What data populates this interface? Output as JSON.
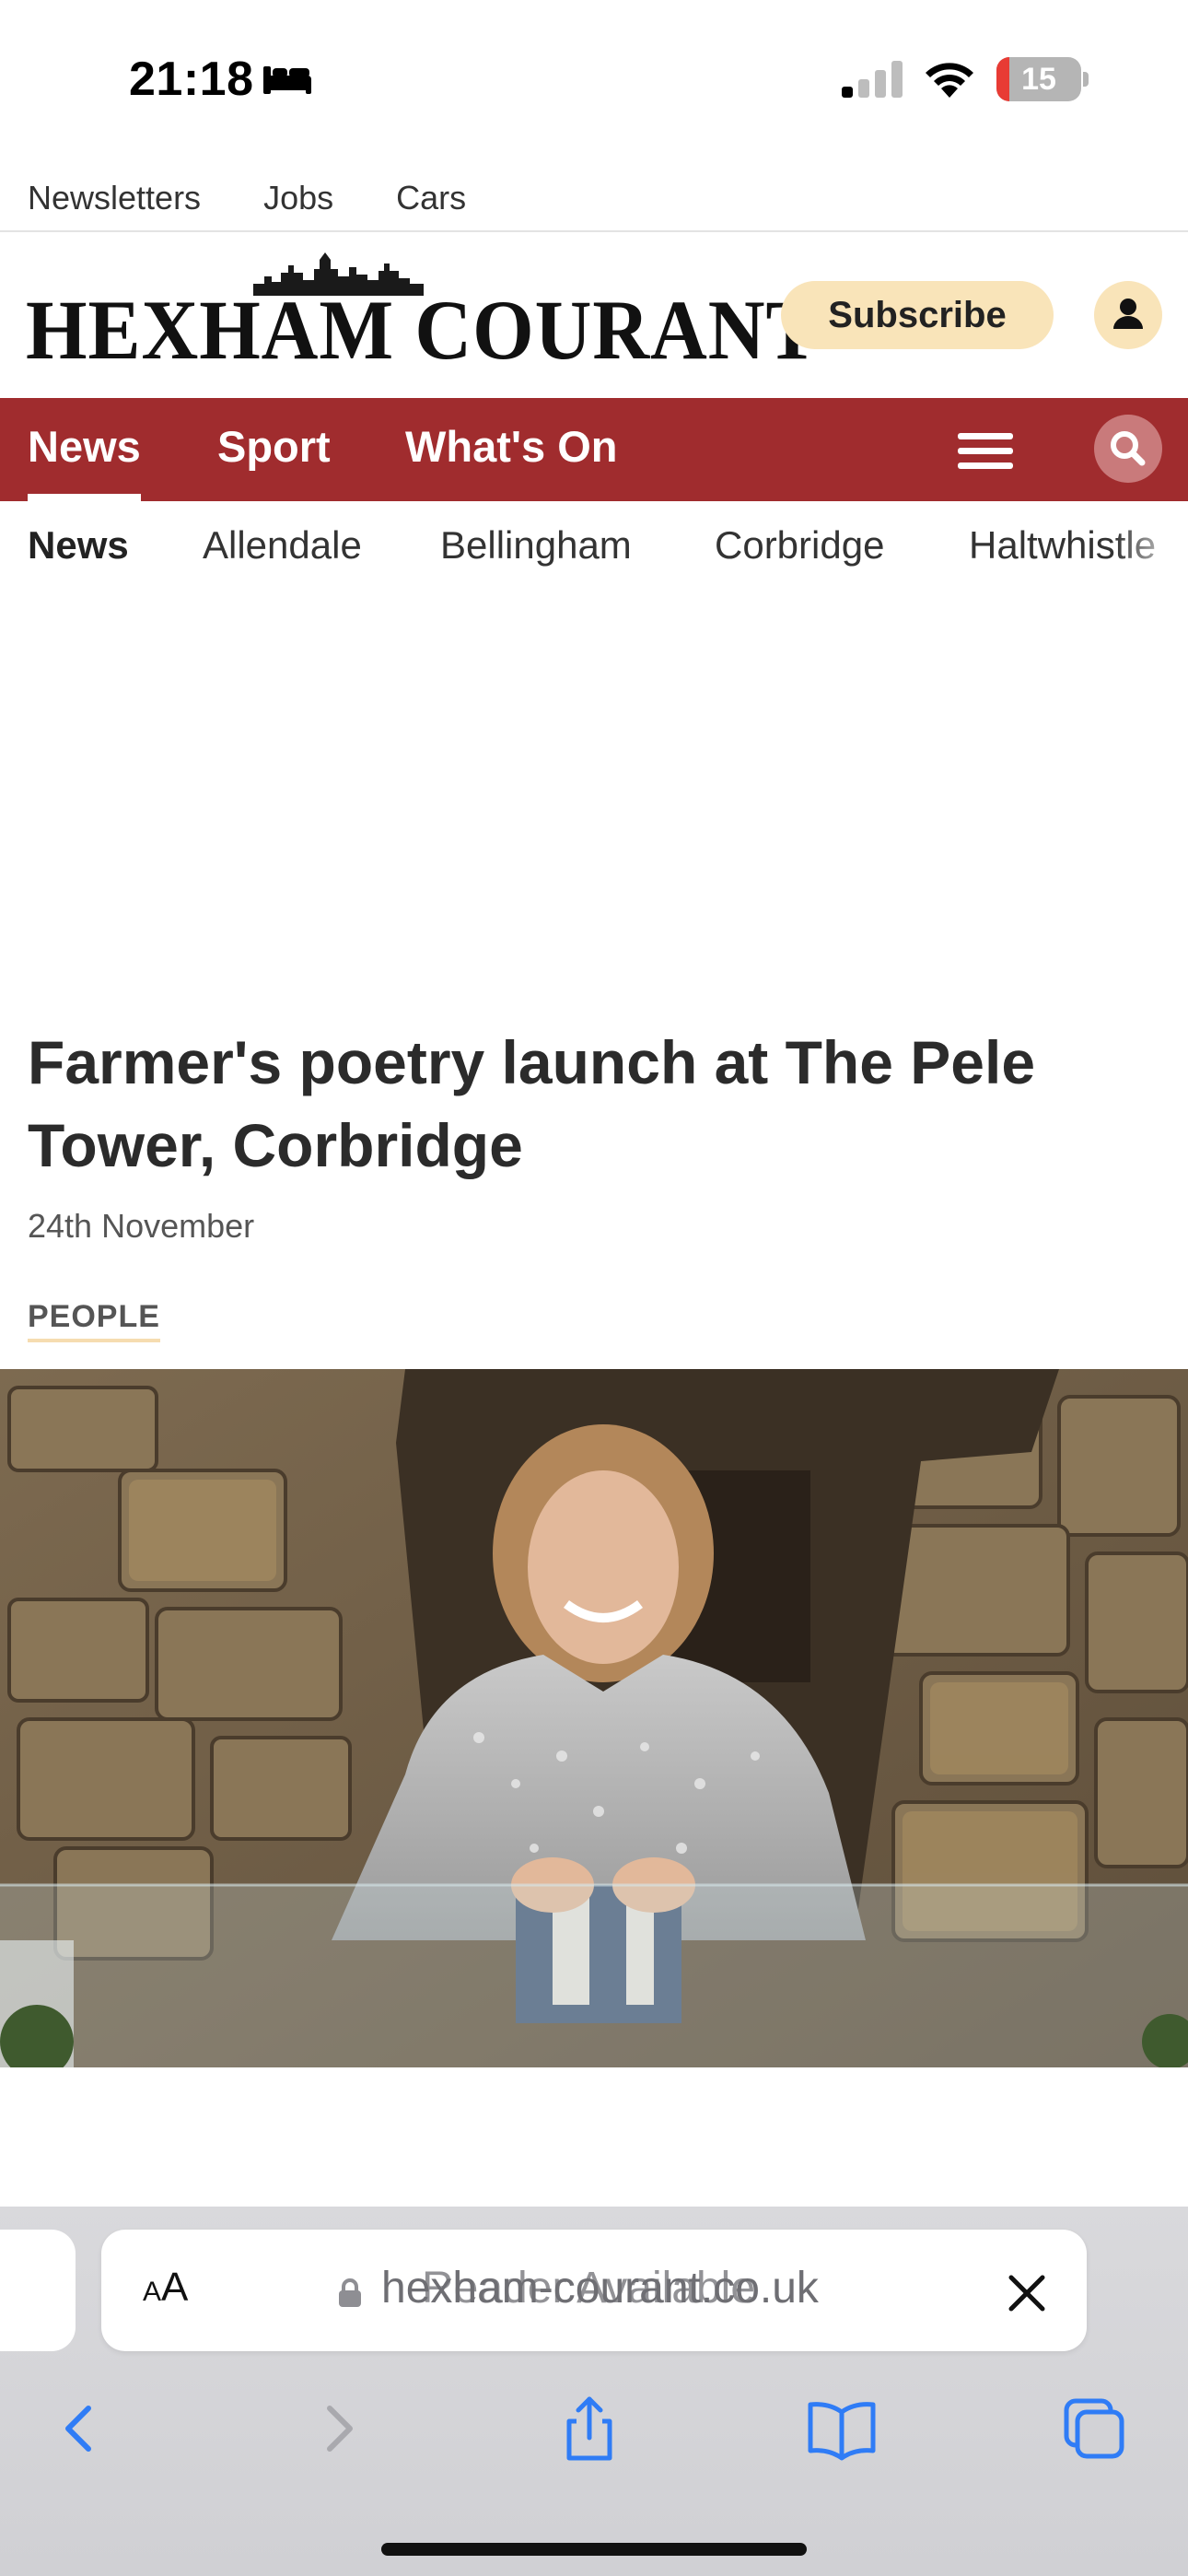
{
  "status_bar": {
    "time": "21:18",
    "battery_level": "15",
    "icons": [
      "bed-icon",
      "cellular-signal-icon",
      "wifi-icon",
      "battery-icon"
    ],
    "battery_color": "#e83b34"
  },
  "top_links": [
    "Newsletters",
    "Jobs",
    "Cars"
  ],
  "masthead": {
    "logo_text": "HEXHAM COURANT",
    "subscribe_label": "Subscribe",
    "account_icon": "user-icon",
    "brand_color": "#a02c2e",
    "accent_color": "#f9e4b9"
  },
  "main_nav": {
    "tabs": [
      "News",
      "Sport",
      "What's On"
    ],
    "active_tab": "News",
    "menu_icon": "hamburger-menu-icon",
    "search_icon": "search-icon"
  },
  "sub_nav": {
    "items": [
      "News",
      "Allendale",
      "Bellingham",
      "Corbridge",
      "Haltwhistle"
    ],
    "active_item": "News"
  },
  "article": {
    "headline": "Farmer's poetry launch at The Pele Tower, Corbridge",
    "date": "24th November",
    "tag": "PEOPLE",
    "image_description": "woman in sequined shirt holding poetry book in front of stone wall"
  },
  "browser": {
    "text_size_label_small": "A",
    "text_size_label_large": "A",
    "url": "hexham-courant.co.uk",
    "reader_label": "Reader Available",
    "toolbar_icons": [
      "back-icon",
      "forward-icon",
      "share-icon",
      "bookmarks-icon",
      "tabs-icon"
    ]
  }
}
